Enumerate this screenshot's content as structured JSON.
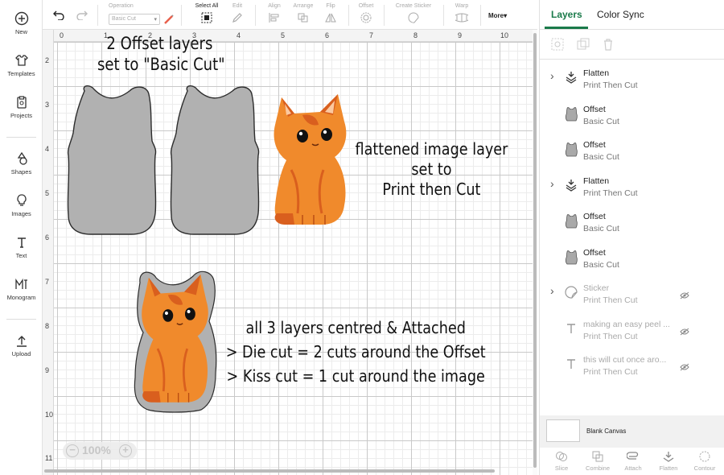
{
  "rail": {
    "new": "New",
    "templates": "Templates",
    "projects": "Projects",
    "shapes": "Shapes",
    "images": "Images",
    "text": "Text",
    "monogram": "Monogram",
    "upload": "Upload"
  },
  "toolbar": {
    "operation_label": "Operation",
    "operation_value": "Basic Cut",
    "select_all": "Select All",
    "edit": "Edit",
    "align": "Align",
    "arrange": "Arrange",
    "flip": "Flip",
    "offset": "Offset",
    "create_sticker": "Create Sticker",
    "warp": "Warp",
    "more": "More"
  },
  "canvas": {
    "ruler_top": [
      "0",
      "1",
      "2",
      "3",
      "4",
      "5",
      "6",
      "7",
      "8",
      "9",
      "10"
    ],
    "ruler_left": [
      "2",
      "3",
      "4",
      "5",
      "6",
      "7",
      "8",
      "9",
      "10",
      "11"
    ],
    "zoom": "100%",
    "annotations": {
      "offset_line1": "2 Offset layers",
      "offset_line2": "set to \"Basic Cut\"",
      "flat_line1": "flattened image layer",
      "flat_line2": "set to",
      "flat_line3": "Print then Cut",
      "bottom_line1": "all 3 layers centred & Attached",
      "bottom_line2": "> Die cut = 2 cuts around the Offset",
      "bottom_line3": "> Kiss cut = 1 cut around the image"
    }
  },
  "panel": {
    "tab_layers": "Layers",
    "tab_color_sync": "Color Sync",
    "layers": [
      {
        "name": "Flatten",
        "sub": "Print Then Cut",
        "icon": "flatten-icon",
        "chevron": true,
        "dim": false,
        "hidden": false
      },
      {
        "name": "Offset",
        "sub": "Basic Cut",
        "icon": "offset-shape-icon",
        "chevron": false,
        "dim": false,
        "hidden": false
      },
      {
        "name": "Offset",
        "sub": "Basic Cut",
        "icon": "offset-shape-icon",
        "chevron": false,
        "dim": false,
        "hidden": false
      },
      {
        "name": "Flatten",
        "sub": "Print Then Cut",
        "icon": "flatten-icon",
        "chevron": true,
        "dim": false,
        "hidden": false
      },
      {
        "name": "Offset",
        "sub": "Basic Cut",
        "icon": "offset-shape-icon",
        "chevron": false,
        "dim": false,
        "hidden": false
      },
      {
        "name": "Offset",
        "sub": "Basic Cut",
        "icon": "offset-shape-icon",
        "chevron": false,
        "dim": false,
        "hidden": false
      },
      {
        "name": "Sticker",
        "sub": "Print Then Cut",
        "icon": "sticker-icon",
        "chevron": true,
        "dim": true,
        "hidden": true
      },
      {
        "name": "making an easy peel ...",
        "sub": "Print Then Cut",
        "icon": "text-icon",
        "chevron": false,
        "dim": true,
        "hidden": true
      },
      {
        "name": "this will cut once aro...",
        "sub": "Print Then Cut",
        "icon": "text-icon",
        "chevron": false,
        "dim": true,
        "hidden": true
      }
    ],
    "blank_canvas": "Blank Canvas",
    "bottom_actions": {
      "slice": "Slice",
      "combine": "Combine",
      "attach": "Attach",
      "flatten": "Flatten",
      "contour": "Contour"
    }
  },
  "colors": {
    "accent": "#1a7a4a",
    "offset_fill": "#b1b1b1",
    "cat_orange": "#f08a2c",
    "cat_dark": "#d95f1e"
  }
}
